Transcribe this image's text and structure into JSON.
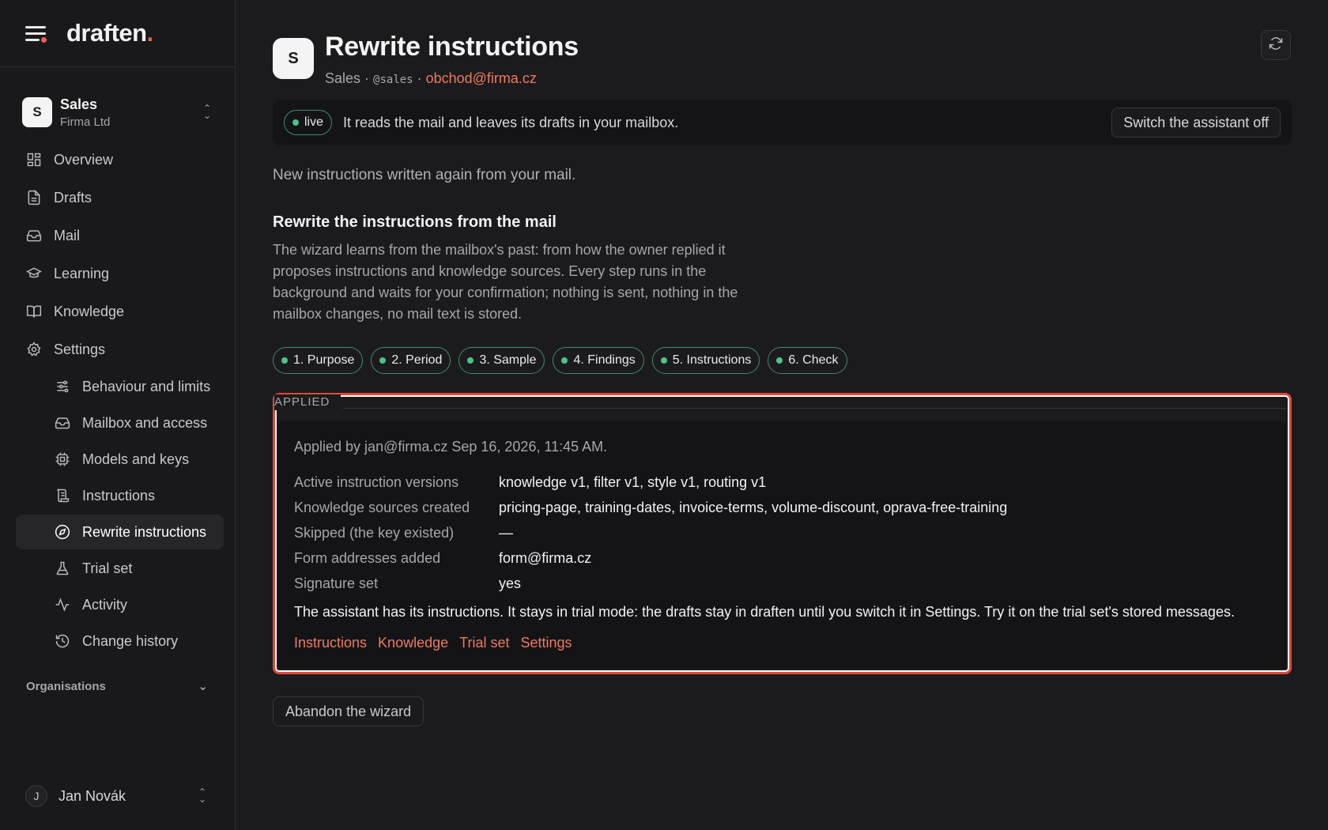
{
  "brand": {
    "logo_text": "draften",
    "logo_dot": "."
  },
  "org": {
    "avatar": "S",
    "name": "Sales",
    "subtitle": "Firma Ltd"
  },
  "nav": {
    "overview": "Overview",
    "drafts": "Drafts",
    "mail": "Mail",
    "learning": "Learning",
    "knowledge": "Knowledge",
    "settings": "Settings",
    "sub": {
      "behaviour": "Behaviour and limits",
      "mailbox": "Mailbox and access",
      "models": "Models and keys",
      "instructions": "Instructions",
      "rewrite": "Rewrite instructions",
      "trial": "Trial set",
      "activity": "Activity",
      "history": "Change history"
    }
  },
  "orgs_section": "Organisations",
  "user": {
    "avatar": "J",
    "name": "Jan Novák"
  },
  "page": {
    "avatar": "S",
    "title": "Rewrite instructions",
    "subtitle_name": "Sales",
    "sep1": " · ",
    "handle": "@sales",
    "sep2": " · ",
    "email": "obchod@firma.cz"
  },
  "live": {
    "badge": "live",
    "text": "It reads the mail and leaves its drafts in your mailbox.",
    "switch_button": "Switch the assistant off"
  },
  "lead": "New instructions written again from your mail.",
  "wizard": {
    "title": "Rewrite the instructions from the mail",
    "description": "The wizard learns from the mailbox's past: from how the owner replied it proposes instructions and knowledge sources. Every step runs in the background and waits for your confirmation; nothing is sent, nothing in the mailbox changes, no mail text is stored.",
    "steps": [
      "1. Purpose",
      "2. Period",
      "3. Sample",
      "4. Findings",
      "5. Instructions",
      "6. Check"
    ]
  },
  "applied": {
    "label": "APPLIED",
    "by": "Applied by jan@firma.cz Sep 16, 2026, 11:45 AM.",
    "rows": [
      {
        "key": "Active instruction versions",
        "value": "knowledge v1, filter v1, style v1, routing v1"
      },
      {
        "key": "Knowledge sources created",
        "value": "pricing-page, training-dates, invoice-terms, volume-discount, oprava-free-training"
      },
      {
        "key": "Skipped (the key existed)",
        "value": "—"
      },
      {
        "key": "Form addresses added",
        "value": "form@firma.cz"
      },
      {
        "key": "Signature set",
        "value": "yes"
      }
    ],
    "message": "The assistant has its instructions. It stays in trial mode: the drafts stay in draften until you switch it in Settings. Try it on the trial set's stored messages.",
    "links": [
      "Instructions",
      "Knowledge",
      "Trial set",
      "Settings"
    ]
  },
  "abandon_button": "Abandon the wizard",
  "colors": {
    "accent": "#ec7a60",
    "live_green": "#4cc38a",
    "highlight_red": "#e0473a"
  }
}
